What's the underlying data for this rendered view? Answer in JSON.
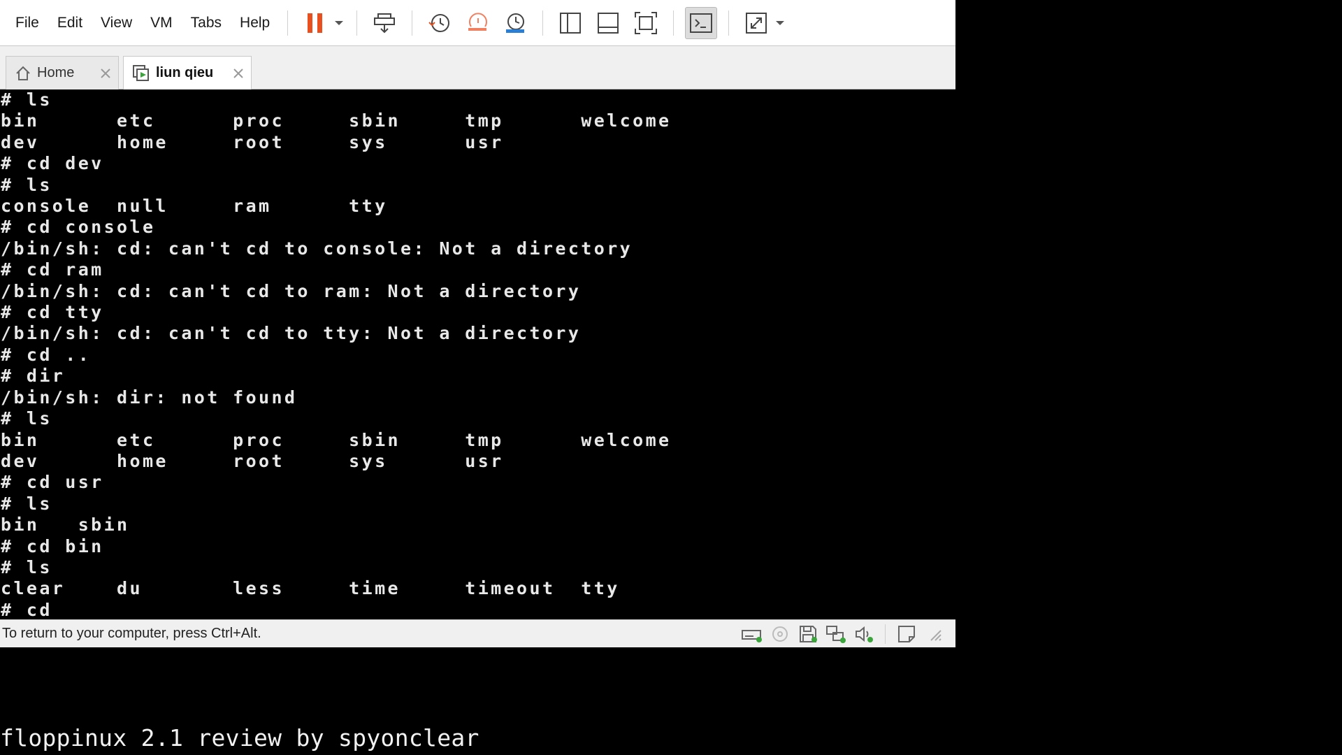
{
  "menu": [
    "File",
    "Edit",
    "View",
    "VM",
    "Tabs",
    "Help"
  ],
  "tabs": [
    {
      "label": "Home",
      "active": false
    },
    {
      "label": "liun qieu",
      "active": true
    }
  ],
  "console": {
    "lines": [
      "# ls",
      "bin      etc      proc     sbin     tmp      welcome",
      "dev      home     root     sys      usr",
      "# cd dev",
      "# ls",
      "console  null     ram      tty",
      "# cd console",
      "/bin/sh: cd: can't cd to console: Not a directory",
      "# cd ram",
      "/bin/sh: cd: can't cd to ram: Not a directory",
      "# cd tty",
      "/bin/sh: cd: can't cd to tty: Not a directory",
      "# cd ..",
      "# dir",
      "/bin/sh: dir: not found",
      "# ls",
      "bin      etc      proc     sbin     tmp      welcome",
      "dev      home     root     sys      usr",
      "# cd usr",
      "# ls",
      "bin   sbin",
      "# cd bin",
      "# ls",
      "clear    du       less     time     timeout  tty",
      "# cd"
    ]
  },
  "status": {
    "text": "To return to your computer, press Ctrl+Alt."
  },
  "caption": "floppinux 2.1 review by spyonclear",
  "colors": {
    "pause": "#e8501f",
    "accent_green": "#3aa53a"
  }
}
